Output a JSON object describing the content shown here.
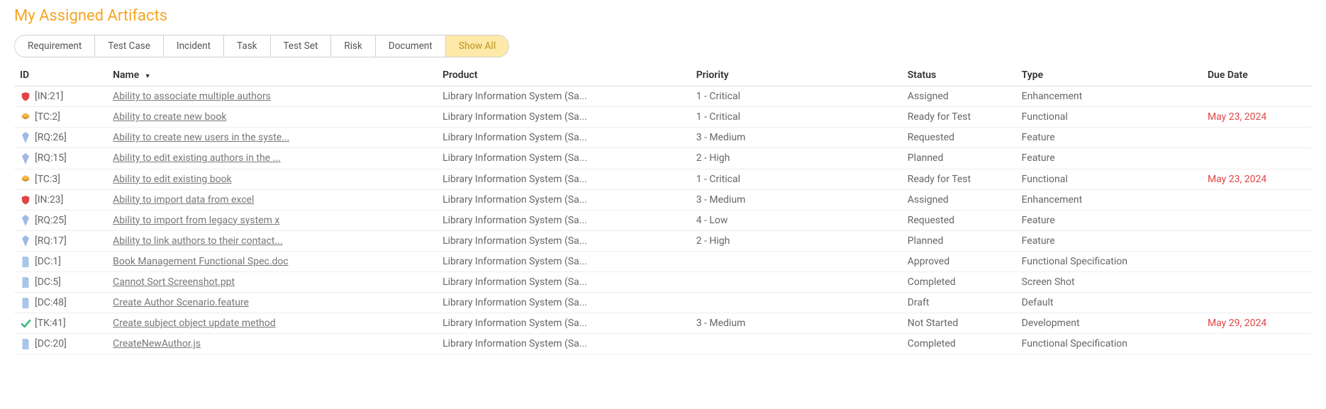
{
  "title": "My Assigned Artifacts",
  "tabs": [
    {
      "label": "Requirement",
      "active": false
    },
    {
      "label": "Test Case",
      "active": false
    },
    {
      "label": "Incident",
      "active": false
    },
    {
      "label": "Task",
      "active": false
    },
    {
      "label": "Test Set",
      "active": false
    },
    {
      "label": "Risk",
      "active": false
    },
    {
      "label": "Document",
      "active": false
    },
    {
      "label": "Show All",
      "active": true
    }
  ],
  "columns": {
    "id": "ID",
    "name": "Name",
    "product": "Product",
    "priority": "Priority",
    "status": "Status",
    "type": "Type",
    "due": "Due Date"
  },
  "sort": {
    "column": "name",
    "direction": "asc"
  },
  "rows": [
    {
      "icon": "incident",
      "id": "[IN:21]",
      "name": "Ability to associate multiple authors",
      "product": "Library Information System (Sa...",
      "priority": "1 - Critical",
      "status": "Assigned",
      "type": "Enhancement",
      "due": ""
    },
    {
      "icon": "testcase",
      "id": "[TC:2]",
      "name": "Ability to create new book",
      "product": "Library Information System (Sa...",
      "priority": "1 - Critical",
      "status": "Ready for Test",
      "type": "Functional",
      "due": "May 23, 2024"
    },
    {
      "icon": "requirement",
      "id": "[RQ:26]",
      "name": "Ability to create new users in the syste...",
      "product": "Library Information System (Sa...",
      "priority": "3 - Medium",
      "status": "Requested",
      "type": "Feature",
      "due": ""
    },
    {
      "icon": "requirement",
      "id": "[RQ:15]",
      "name": "Ability to edit existing authors in the ...",
      "product": "Library Information System (Sa...",
      "priority": "2 - High",
      "status": "Planned",
      "type": "Feature",
      "due": ""
    },
    {
      "icon": "testcase",
      "id": "[TC:3]",
      "name": "Ability to edit existing book",
      "product": "Library Information System (Sa...",
      "priority": "1 - Critical",
      "status": "Ready for Test",
      "type": "Functional",
      "due": "May 23, 2024"
    },
    {
      "icon": "incident",
      "id": "[IN:23]",
      "name": "Ability to import data from excel",
      "product": "Library Information System (Sa...",
      "priority": "3 - Medium",
      "status": "Assigned",
      "type": "Enhancement",
      "due": ""
    },
    {
      "icon": "requirement",
      "id": "[RQ:25]",
      "name": "Ability to import from legacy system x",
      "product": "Library Information System (Sa...",
      "priority": "4 - Low",
      "status": "Requested",
      "type": "Feature",
      "due": ""
    },
    {
      "icon": "requirement",
      "id": "[RQ:17]",
      "name": "Ability to link authors to their contact...",
      "product": "Library Information System (Sa...",
      "priority": "2 - High",
      "status": "Planned",
      "type": "Feature",
      "due": ""
    },
    {
      "icon": "document",
      "id": "[DC:1]",
      "name": "Book Management Functional Spec.doc",
      "product": "Library Information System (Sa...",
      "priority": "",
      "status": "Approved",
      "type": "Functional Specification",
      "due": ""
    },
    {
      "icon": "document",
      "id": "[DC:5]",
      "name": "Cannot Sort Screenshot.ppt",
      "product": "Library Information System (Sa...",
      "priority": "",
      "status": "Completed",
      "type": "Screen Shot",
      "due": ""
    },
    {
      "icon": "document",
      "id": "[DC:48]",
      "name": "Create Author Scenario.feature",
      "product": "Library Information System (Sa...",
      "priority": "",
      "status": "Draft",
      "type": "Default",
      "due": ""
    },
    {
      "icon": "task",
      "id": "[TK:41]",
      "name": "Create subject object update method",
      "product": "Library Information System (Sa...",
      "priority": "3 - Medium",
      "status": "Not Started",
      "type": "Development",
      "due": "May 29, 2024"
    },
    {
      "icon": "document",
      "id": "[DC:20]",
      "name": "CreateNewAuthor.js",
      "product": "Library Information System (Sa...",
      "priority": "",
      "status": "Completed",
      "type": "Functional Specification",
      "due": ""
    }
  ]
}
